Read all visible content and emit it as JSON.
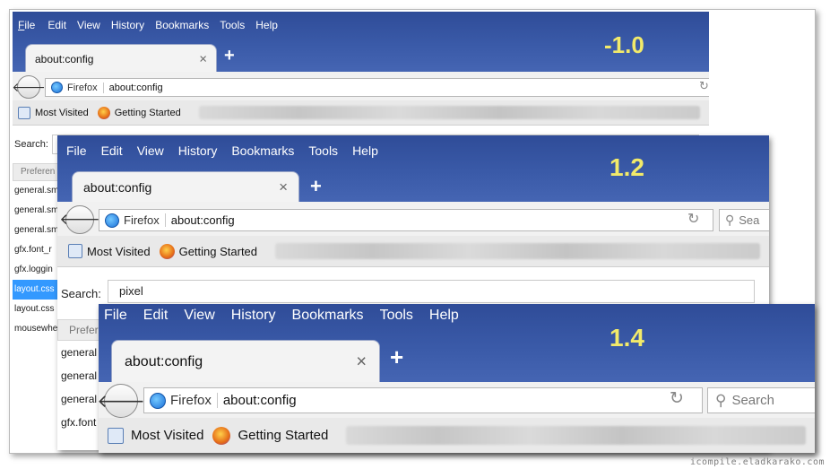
{
  "menus": [
    "File",
    "Edit",
    "View",
    "History",
    "Bookmarks",
    "Tools",
    "Help"
  ],
  "tab": {
    "title": "about:config",
    "close": "×",
    "new_tab": "+"
  },
  "urlbar": {
    "identity": "Firefox",
    "url": "about:config",
    "reload": "↻"
  },
  "search_box": {
    "placeholder": "Search",
    "placeholder_short": "Sea"
  },
  "bookmarks": {
    "most_visited": "Most Visited",
    "getting_started": "Getting Started"
  },
  "config": {
    "search_label": "Search:",
    "search_value": "pixel",
    "column_header": "Preferen",
    "column_header_short": "Prefer",
    "rows_v10": [
      "general.sm",
      "general.sm",
      "general.sm",
      "gfx.font_r",
      "gfx.loggin",
      "layout.css",
      "layout.css",
      "mousewhe"
    ],
    "rows_v12": [
      "general",
      "general",
      "general",
      "gfx.font"
    ]
  },
  "versions": {
    "v10": "-1.0",
    "v12": "1.2",
    "v14": "1.4"
  },
  "credit": "icompile.eladkarako.com",
  "colors": {
    "titlebar": "#3a5aa8",
    "version_label": "#f2ea6a",
    "selection": "#3399ff"
  }
}
